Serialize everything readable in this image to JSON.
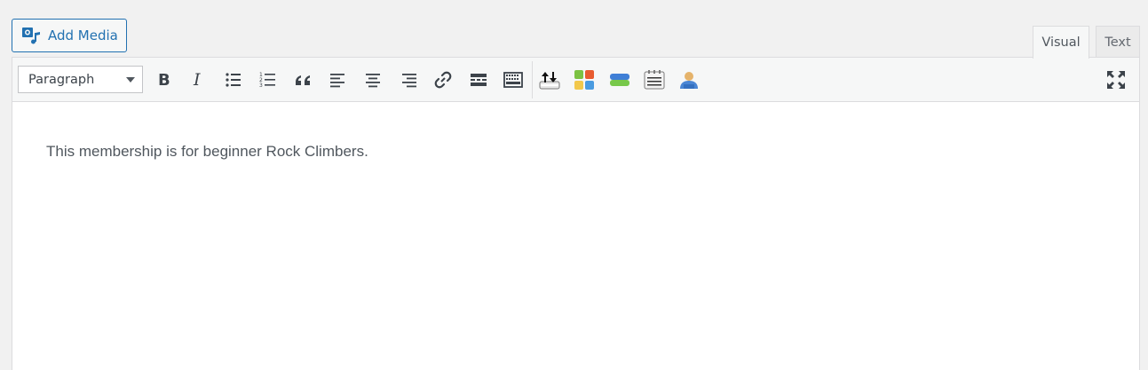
{
  "media_button": {
    "label": "Add Media",
    "icon": "media-camera-music-icon",
    "color": "#2271b1"
  },
  "tabs": [
    {
      "label": "Visual",
      "active": true
    },
    {
      "label": "Text",
      "active": false
    }
  ],
  "toolbar": {
    "format_select": {
      "value": "Paragraph"
    },
    "buttons": [
      "bold-icon",
      "italic-icon",
      "bulleted-list-icon",
      "numbered-list-icon",
      "blockquote-icon",
      "align-left-icon",
      "align-center-icon",
      "align-right-icon",
      "link-icon",
      "read-more-icon",
      "toolbar-toggle-icon",
      "upload-arrows-icon",
      "color-blocks-icon",
      "layers-icon",
      "notepad-icon",
      "user-icon",
      "fullscreen-icon"
    ]
  },
  "content": {
    "text": "This membership is for beginner Rock Climbers."
  }
}
